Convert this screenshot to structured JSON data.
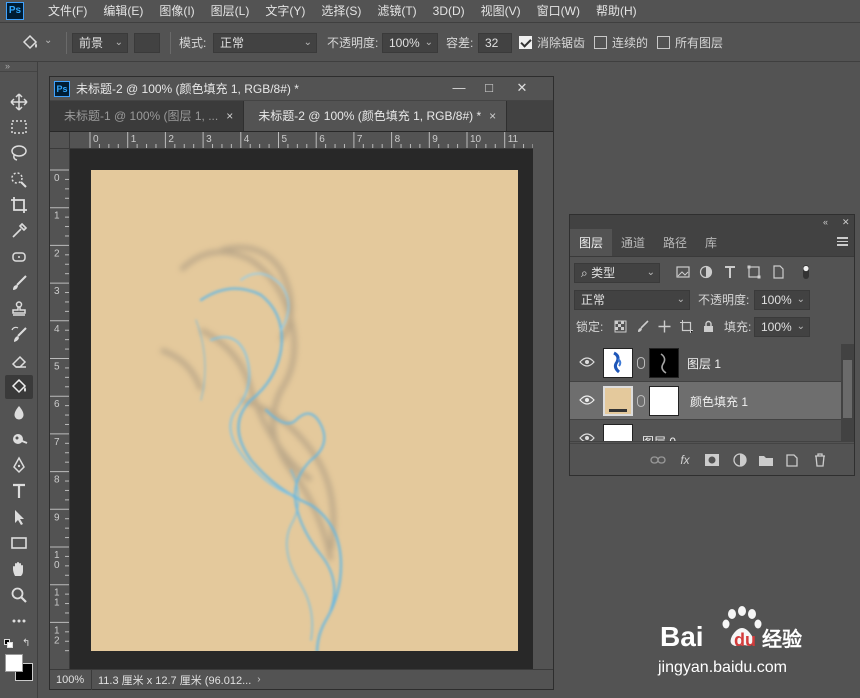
{
  "app": {
    "logo": "Ps"
  },
  "menu": [
    "文件(F)",
    "编辑(E)",
    "图像(I)",
    "图层(L)",
    "文字(Y)",
    "选择(S)",
    "滤镜(T)",
    "3D(D)",
    "视图(V)",
    "窗口(W)",
    "帮助(H)"
  ],
  "options": {
    "fill_source": "前景",
    "mode_label": "模式:",
    "mode_value": "正常",
    "opacity_label": "不透明度:",
    "opacity_value": "100%",
    "tolerance_label": "容差:",
    "tolerance_value": "32",
    "antialias_label": "消除锯齿",
    "antialias_checked": true,
    "contiguous_label": "连续的",
    "contiguous_checked": false,
    "all_layers_label": "所有图层",
    "all_layers_checked": false
  },
  "document": {
    "window_title": "未标题-2 @ 100% (颜色填充 1, RGB/8#) *",
    "tabs": [
      {
        "label": "未标题-1 @ 100% (图层 1, ...",
        "active": false,
        "close": "×"
      },
      {
        "label": "未标题-2 @ 100% (颜色填充 1, RGB/8#) *",
        "active": true,
        "close": "×"
      }
    ],
    "canvas_color": "#e4c99c",
    "ruler_h_labels": [
      "0",
      "1",
      "2",
      "3",
      "4",
      "5",
      "6",
      "7",
      "8",
      "9",
      "10",
      "11",
      "12"
    ],
    "ruler_v_labels": [
      "0",
      "1",
      "2",
      "3",
      "4",
      "5",
      "6",
      "7",
      "8",
      "9",
      "10",
      "11",
      "12"
    ],
    "zoom": "100%",
    "info": "11.3 厘米 x 12.7 厘米 (96.012..."
  },
  "layers_panel": {
    "tabs": [
      "图层",
      "通道",
      "路径",
      "库"
    ],
    "active_tab": "图层",
    "filter_kind": "类型",
    "blend_mode": "正常",
    "opacity_label": "不透明度:",
    "opacity_value": "100%",
    "lock_label": "锁定:",
    "fill_label": "填充:",
    "fill_value": "100%",
    "layers": [
      {
        "name": "图层 1",
        "visible": true,
        "selected": false
      },
      {
        "name": "颜色填充 1",
        "visible": true,
        "selected": true
      },
      {
        "name": "图层 0",
        "visible": true,
        "selected": false
      }
    ],
    "footer_icons": [
      "link-icon",
      "fx-icon",
      "mask-icon",
      "adjustment-icon",
      "group-folder-icon",
      "new-layer-icon",
      "trash-icon"
    ],
    "fx_label": "fx"
  },
  "colors": {
    "foreground": "#ffffff",
    "background": "#000000",
    "smoke_blue": "#5fb7e8"
  },
  "watermark": {
    "brand": "Bai",
    "brand2": "du",
    "suffix": "经验",
    "url": "jingyan.baidu.com"
  }
}
